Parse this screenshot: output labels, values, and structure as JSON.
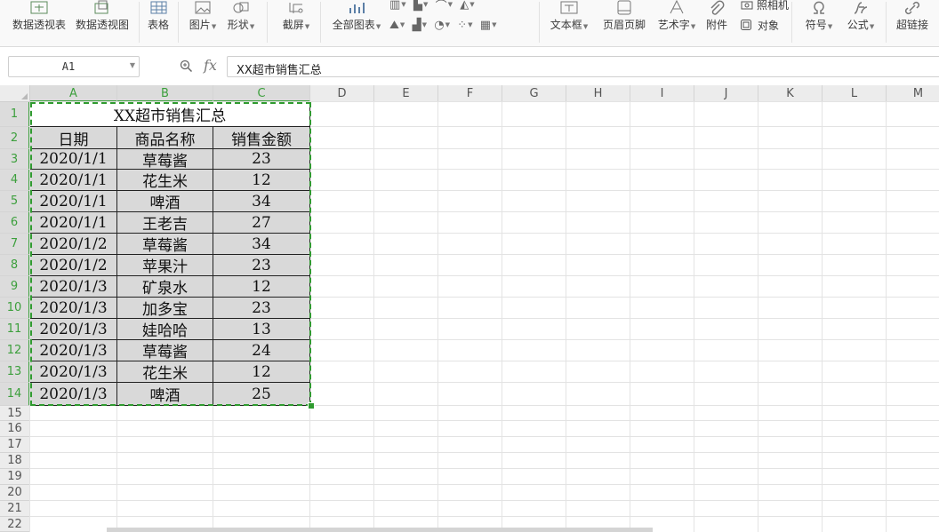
{
  "ribbon": {
    "buttons": [
      {
        "label": "数据透视表",
        "icon": "pivot-table-icon",
        "dropdown": false
      },
      {
        "label": "数据透视图",
        "icon": "pivot-chart-icon",
        "dropdown": false
      },
      {
        "label": "表格",
        "icon": "table-icon",
        "dropdown": false
      },
      {
        "label": "图片",
        "icon": "picture-icon",
        "dropdown": true
      },
      {
        "label": "形状",
        "icon": "shape-icon",
        "dropdown": true
      },
      {
        "label": "截屏",
        "icon": "screenshot-icon",
        "dropdown": true
      },
      {
        "label": "全部图表",
        "icon": "all-charts-icon",
        "dropdown": true
      },
      {
        "label": "文本框",
        "icon": "textbox-icon",
        "dropdown": true
      },
      {
        "label": "页眉页脚",
        "icon": "header-footer-icon",
        "dropdown": false
      },
      {
        "label": "艺术字",
        "icon": "wordart-icon",
        "dropdown": true
      },
      {
        "label": "附件",
        "icon": "attachment-icon",
        "dropdown": false
      },
      {
        "label": "符号",
        "icon": "symbol-icon",
        "dropdown": true
      },
      {
        "label": "公式",
        "icon": "formula-icon",
        "dropdown": true
      },
      {
        "label": "超链接",
        "icon": "hyperlink-icon",
        "dropdown": false
      }
    ],
    "camera_label": "照相机",
    "object_label": "对象"
  },
  "formula_bar": {
    "name_box": "A1",
    "fx": "fx",
    "content": "XX超市销售汇总"
  },
  "grid": {
    "columns": [
      "A",
      "B",
      "C",
      "D",
      "E",
      "F",
      "G",
      "H",
      "I",
      "J",
      "K",
      "L",
      "M"
    ],
    "rows": [
      "1",
      "2",
      "3",
      "4",
      "5",
      "6",
      "7",
      "8",
      "9",
      "10",
      "11",
      "12",
      "13",
      "14",
      "15",
      "16",
      "17",
      "18",
      "19",
      "20",
      "21",
      "22"
    ],
    "selected_columns": [
      "A",
      "B",
      "C"
    ],
    "selected_rows_count": 14
  },
  "sheet": {
    "title": "XX超市销售汇总",
    "headers": [
      "日期",
      "商品名称",
      "销售金额"
    ],
    "rows": [
      [
        "2020/1/1",
        "草莓酱",
        "23"
      ],
      [
        "2020/1/1",
        "花生米",
        "12"
      ],
      [
        "2020/1/1",
        "啤酒",
        "34"
      ],
      [
        "2020/1/1",
        "王老吉",
        "27"
      ],
      [
        "2020/1/2",
        "草莓酱",
        "34"
      ],
      [
        "2020/1/2",
        "苹果汁",
        "23"
      ],
      [
        "2020/1/3",
        "矿泉水",
        "12"
      ],
      [
        "2020/1/3",
        "加多宝",
        "23"
      ],
      [
        "2020/1/3",
        "娃哈哈",
        "13"
      ],
      [
        "2020/1/3",
        "草莓酱",
        "24"
      ],
      [
        "2020/1/3",
        "花生米",
        "12"
      ],
      [
        "2020/1/3",
        "啤酒",
        "25"
      ]
    ]
  },
  "colors": {
    "selection": "#2f9b2f",
    "cell_fill": "#d9d9d9"
  }
}
